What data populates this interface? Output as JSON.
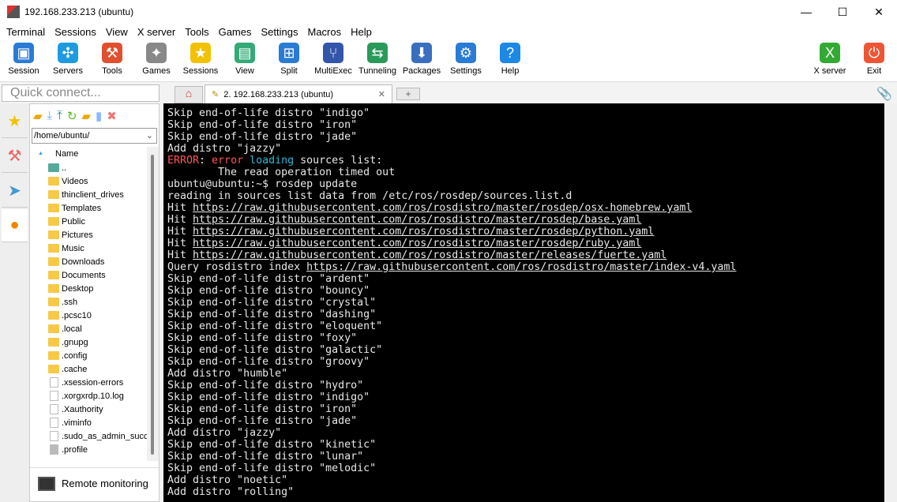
{
  "window": {
    "title": "192.168.233.213 (ubuntu)",
    "min": "—",
    "max": "☐",
    "close": "✕"
  },
  "menu": [
    "Terminal",
    "Sessions",
    "View",
    "X server",
    "Tools",
    "Games",
    "Settings",
    "Macros",
    "Help"
  ],
  "toolbar": [
    {
      "label": "Session",
      "icon": "session-icon",
      "color": "#2a7bd4",
      "glyph": "▣"
    },
    {
      "label": "Servers",
      "icon": "servers-icon",
      "color": "#1e9be0",
      "glyph": "✣"
    },
    {
      "label": "Tools",
      "icon": "tools-icon",
      "color": "#e05030",
      "glyph": "⚒"
    },
    {
      "label": "Games",
      "icon": "games-icon",
      "color": "#888",
      "glyph": "✦"
    },
    {
      "label": "Sessions",
      "icon": "star-icon",
      "color": "#f2c200",
      "glyph": "★"
    },
    {
      "label": "View",
      "icon": "view-icon",
      "color": "#3a7",
      "glyph": "▤"
    },
    {
      "label": "Split",
      "icon": "split-icon",
      "color": "#2a7bd4",
      "glyph": "⊞"
    },
    {
      "label": "MultiExec",
      "icon": "multiexec-icon",
      "color": "#3355aa",
      "glyph": "⑂"
    },
    {
      "label": "Tunneling",
      "icon": "tunneling-icon",
      "color": "#2a9a5a",
      "glyph": "⇆"
    },
    {
      "label": "Packages",
      "icon": "packages-icon",
      "color": "#3a6fc0",
      "glyph": "⬇"
    },
    {
      "label": "Settings",
      "icon": "settings-icon",
      "color": "#2a7bd4",
      "glyph": "⚙"
    },
    {
      "label": "Help",
      "icon": "help-icon",
      "color": "#1e88e5",
      "glyph": "?"
    }
  ],
  "toolbar_right": [
    {
      "label": "X server",
      "icon": "x-server-icon",
      "color": "#3a3",
      "glyph": "X"
    },
    {
      "label": "Exit",
      "icon": "exit-icon",
      "color": "#e53",
      "glyph": "⏻"
    }
  ],
  "quick_connect": {
    "placeholder": "Quick connect..."
  },
  "tabs": {
    "active": "2. 192.168.233.213 (ubuntu)",
    "close": "✕",
    "add": "+"
  },
  "sftp": {
    "path": "/home/ubuntu/",
    "column": "Name",
    "files": [
      {
        "name": "..",
        "type": "up"
      },
      {
        "name": "Videos",
        "type": "folder"
      },
      {
        "name": "thinclient_drives",
        "type": "folder"
      },
      {
        "name": "Templates",
        "type": "folder"
      },
      {
        "name": "Public",
        "type": "folder"
      },
      {
        "name": "Pictures",
        "type": "folder"
      },
      {
        "name": "Music",
        "type": "folder"
      },
      {
        "name": "Downloads",
        "type": "folder"
      },
      {
        "name": "Documents",
        "type": "folder"
      },
      {
        "name": "Desktop",
        "type": "folder"
      },
      {
        "name": ".ssh",
        "type": "folder"
      },
      {
        "name": ".pcsc10",
        "type": "folder"
      },
      {
        "name": ".local",
        "type": "folder"
      },
      {
        "name": ".gnupg",
        "type": "folder"
      },
      {
        "name": ".config",
        "type": "folder"
      },
      {
        "name": ".cache",
        "type": "folder"
      },
      {
        "name": ".xsession-errors",
        "type": "file"
      },
      {
        "name": ".xorgxrdp.10.log",
        "type": "file"
      },
      {
        "name": ".Xauthority",
        "type": "file"
      },
      {
        "name": ".viminfo",
        "type": "file"
      },
      {
        "name": ".sudo_as_admin_successful",
        "type": "file"
      },
      {
        "name": ".profile",
        "type": "file-gray"
      }
    ],
    "remote_monitoring": "Remote monitoring"
  },
  "terminal": {
    "lines": [
      [
        {
          "t": "Skip end-of-life distro \"indigo\""
        }
      ],
      [
        {
          "t": "Skip end-of-life distro \"iron\""
        }
      ],
      [
        {
          "t": "Skip end-of-life distro \"jade\""
        }
      ],
      [
        {
          "t": "Add distro \"jazzy\""
        }
      ],
      [
        {
          "t": "ERROR",
          "c": "#ff5555"
        },
        {
          "t": ": "
        },
        {
          "t": "error",
          "c": "#ff5555"
        },
        {
          "t": " "
        },
        {
          "t": "loading",
          "c": "#2bb8d8"
        },
        {
          "t": " sources list:"
        }
      ],
      [
        {
          "t": "        The read operation timed out"
        }
      ],
      [
        {
          "t": "ubuntu@ubuntu:~$ rosdep update"
        }
      ],
      [
        {
          "t": "reading in sources list data from /etc/ros/rosdep/sources.list.d"
        }
      ],
      [
        {
          "t": "Hit "
        },
        {
          "t": "https://raw.githubusercontent.com/ros/rosdistro/master/rosdep/osx-homebrew.yaml",
          "u": 1
        }
      ],
      [
        {
          "t": "Hit "
        },
        {
          "t": "https://raw.githubusercontent.com/ros/rosdistro/master/rosdep/base.yaml",
          "u": 1
        }
      ],
      [
        {
          "t": "Hit "
        },
        {
          "t": "https://raw.githubusercontent.com/ros/rosdistro/master/rosdep/python.yaml",
          "u": 1
        }
      ],
      [
        {
          "t": "Hit "
        },
        {
          "t": "https://raw.githubusercontent.com/ros/rosdistro/master/rosdep/ruby.yaml",
          "u": 1
        }
      ],
      [
        {
          "t": "Hit "
        },
        {
          "t": "https://raw.githubusercontent.com/ros/rosdistro/master/releases/fuerte.yaml",
          "u": 1
        }
      ],
      [
        {
          "t": "Query rosdistro index "
        },
        {
          "t": "https://raw.githubusercontent.com/ros/rosdistro/master/index-v4.yaml",
          "u": 1
        }
      ],
      [
        {
          "t": "Skip end-of-life distro \"ardent\""
        }
      ],
      [
        {
          "t": "Skip end-of-life distro \"bouncy\""
        }
      ],
      [
        {
          "t": "Skip end-of-life distro \"crystal\""
        }
      ],
      [
        {
          "t": "Skip end-of-life distro \"dashing\""
        }
      ],
      [
        {
          "t": "Skip end-of-life distro \"eloquent\""
        }
      ],
      [
        {
          "t": "Skip end-of-life distro \"foxy\""
        }
      ],
      [
        {
          "t": "Skip end-of-life distro \"galactic\""
        }
      ],
      [
        {
          "t": "Skip end-of-life distro \"groovy\""
        }
      ],
      [
        {
          "t": "Add distro \"humble\""
        }
      ],
      [
        {
          "t": "Skip end-of-life distro \"hydro\""
        }
      ],
      [
        {
          "t": "Skip end-of-life distro \"indigo\""
        }
      ],
      [
        {
          "t": "Skip end-of-life distro \"iron\""
        }
      ],
      [
        {
          "t": "Skip end-of-life distro \"jade\""
        }
      ],
      [
        {
          "t": "Add distro \"jazzy\""
        }
      ],
      [
        {
          "t": "Skip end-of-life distro \"kinetic\""
        }
      ],
      [
        {
          "t": "Skip end-of-life distro \"lunar\""
        }
      ],
      [
        {
          "t": "Skip end-of-life distro \"melodic\""
        }
      ],
      [
        {
          "t": "Add distro \"noetic\""
        }
      ],
      [
        {
          "t": "Add distro \"rolling\""
        }
      ]
    ]
  }
}
